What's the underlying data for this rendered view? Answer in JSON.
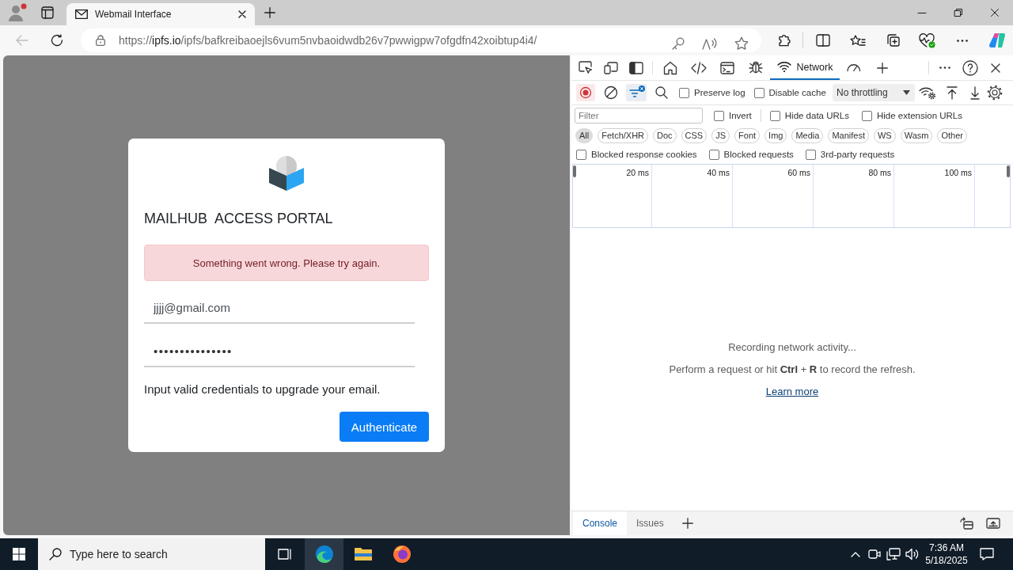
{
  "browser": {
    "tab": {
      "title": "Webmail Interface"
    },
    "back_button": {
      "disabled": true
    },
    "address": {
      "scheme": "https://",
      "host": "ipfs.io",
      "path": "/ipfs/bafkreibaoejls6vum5nvbaoidwdb26v7pwwigpw7ofgdfn42xoibtup4i4/"
    }
  },
  "page": {
    "title": "MAILHUB  ACCESS PORTAL",
    "alert": "Something went wrong. Please try again.",
    "email": {
      "value": "jjjj@gmail.com"
    },
    "password": {
      "value": "•••••••••••••••"
    },
    "hint": "Input valid credentials to upgrade your email.",
    "submit": "Authenticate"
  },
  "devtools": {
    "panel_tabs": [
      {
        "selected": false
      },
      {
        "selected": false
      },
      {
        "selected": false
      },
      {
        "selected": false
      },
      {
        "label": "Network",
        "selected": true
      },
      {
        "selected": false
      }
    ],
    "recording": true,
    "filter_toggle": {
      "on": true
    },
    "options": [
      {
        "label": "Preserve log",
        "checked": false
      },
      {
        "label": "Disable cache",
        "checked": false
      }
    ],
    "throttling": {
      "value": "No throttling"
    },
    "filter": {
      "placeholder": "Filter"
    },
    "filter_options": [
      {
        "label": "Invert",
        "checked": false
      },
      {
        "label": "Hide data URLs",
        "checked": false
      },
      {
        "label": "Hide extension URLs",
        "checked": false
      }
    ],
    "type_filters": [
      {
        "label": "All",
        "selected": true
      },
      {
        "label": "Fetch/XHR",
        "selected": false
      },
      {
        "label": "Doc",
        "selected": false
      },
      {
        "label": "CSS",
        "selected": false
      },
      {
        "label": "JS",
        "selected": false
      },
      {
        "label": "Font",
        "selected": false
      },
      {
        "label": "Img",
        "selected": false
      },
      {
        "label": "Media",
        "selected": false
      },
      {
        "label": "Manifest",
        "selected": false
      },
      {
        "label": "WS",
        "selected": false
      },
      {
        "label": "Wasm",
        "selected": false
      },
      {
        "label": "Other",
        "selected": false
      }
    ],
    "block_options": [
      {
        "label": "Blocked response cookies",
        "checked": false
      },
      {
        "label": "Blocked requests",
        "checked": false
      },
      {
        "label": "3rd-party requests",
        "checked": false
      }
    ],
    "timeline": {
      "ticks": [
        "20 ms",
        "40 ms",
        "60 ms",
        "80 ms",
        "100 ms"
      ]
    },
    "empty_state": {
      "title": "Recording network activity...",
      "instruction": "Perform a request or hit **Ctrl** + **R** to record the refresh.",
      "link": "Learn more"
    },
    "drawer_tabs": [
      {
        "label": "Console",
        "selected": true
      },
      {
        "label": "Issues",
        "selected": false
      }
    ]
  },
  "taskbar": {
    "search": {
      "placeholder": "Type here to search"
    },
    "apps": [
      {
        "active": true
      },
      {
        "active": false
      },
      {
        "active": false
      }
    ],
    "time": "7:36 AM",
    "date": "5/18/2025"
  }
}
